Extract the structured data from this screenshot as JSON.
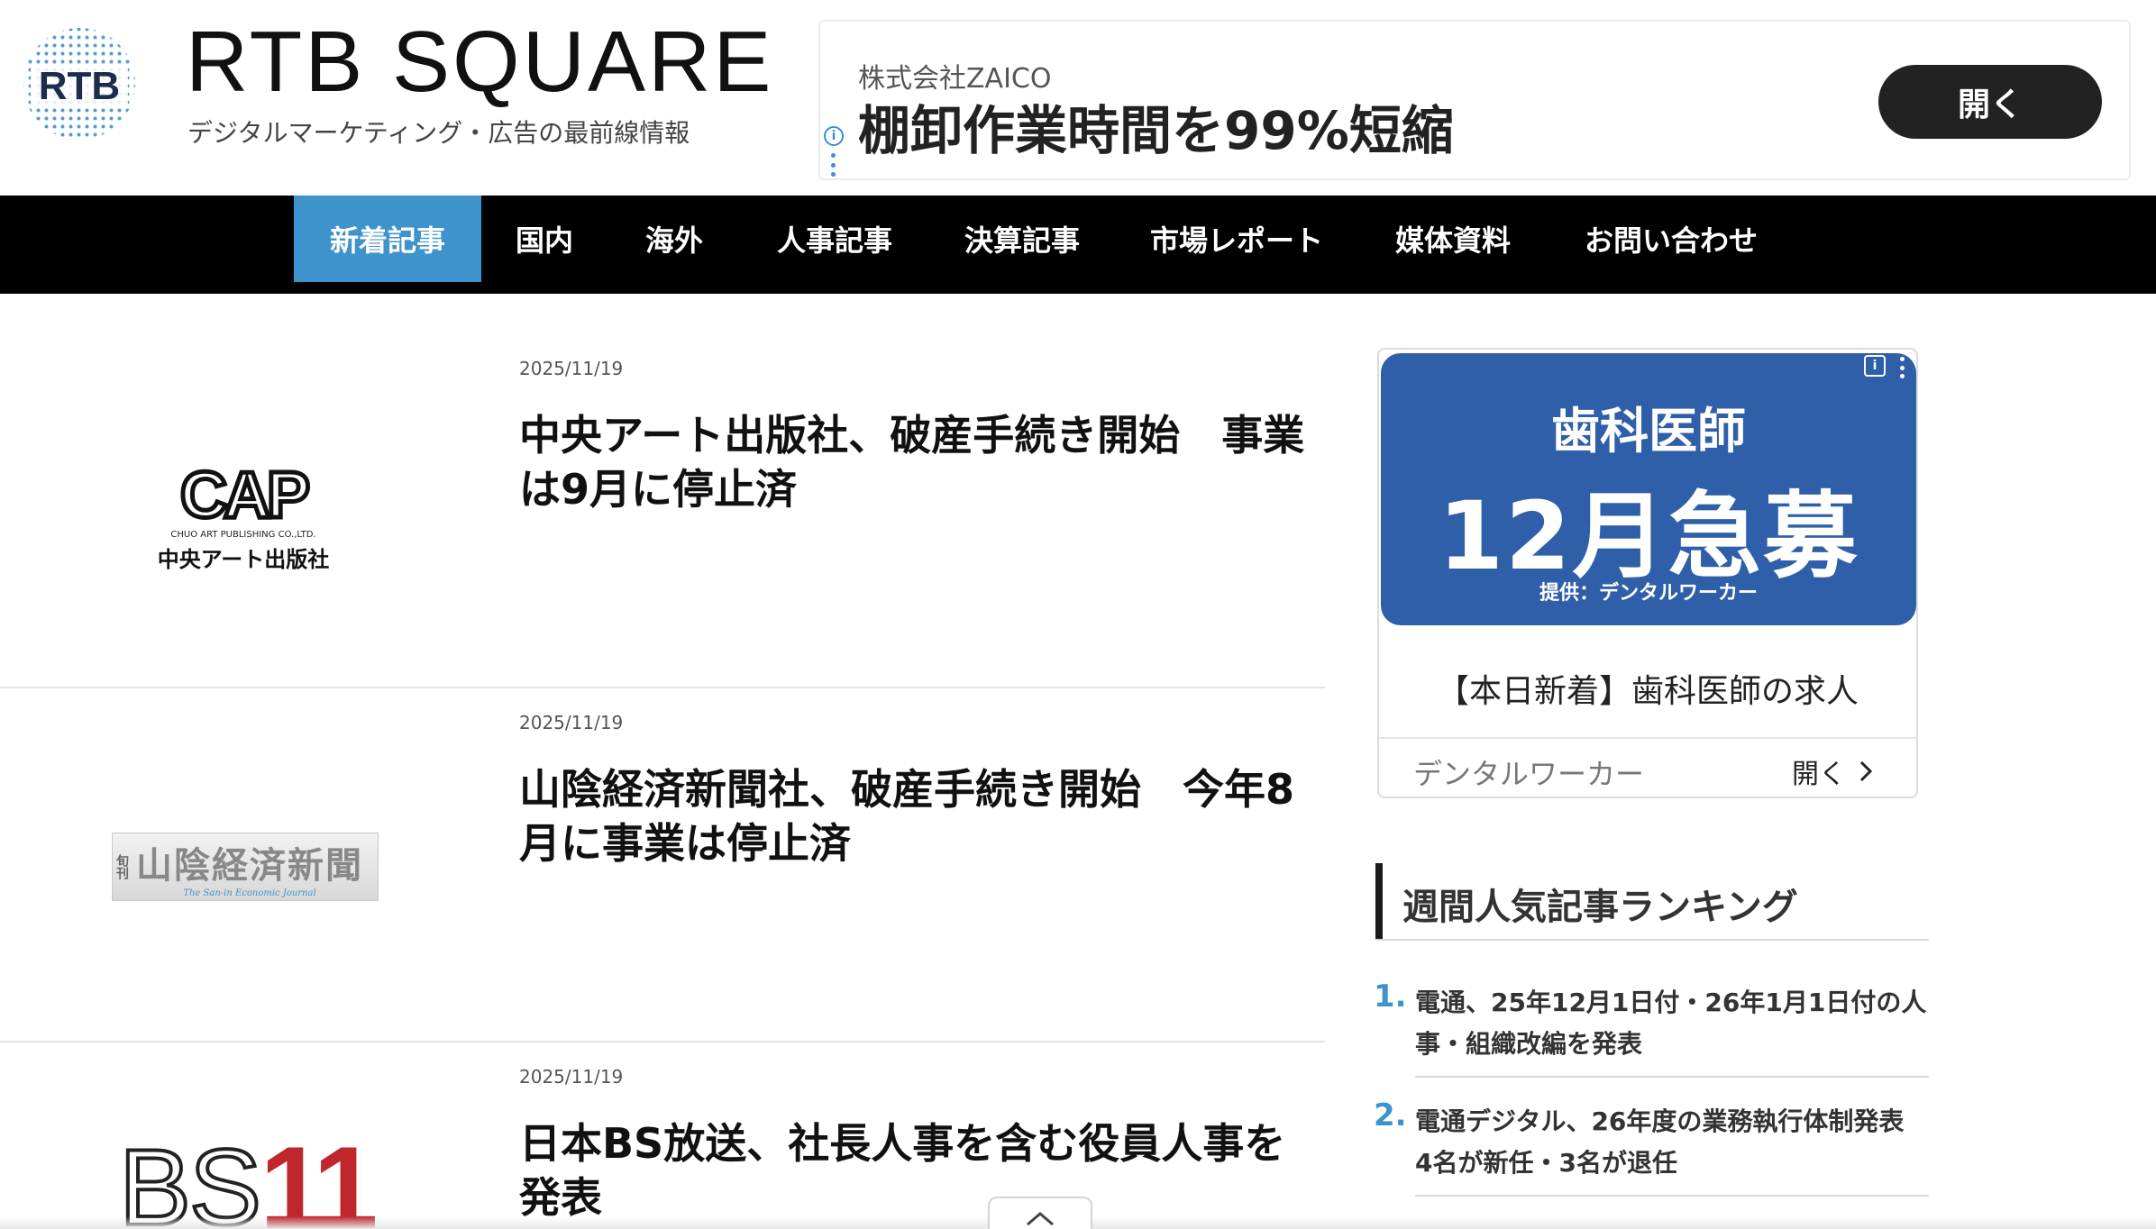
{
  "header": {
    "site_title": "RTB SQUARE",
    "logo_text": "RTB",
    "subtitle": "デジタルマーケティング・広告の最前線情報"
  },
  "top_ad": {
    "company": "株式会社ZAICO",
    "headline": "棚卸作業時間を99%短縮",
    "button": "開く",
    "info_icon": "i"
  },
  "nav": {
    "items": [
      {
        "label": "新着記事",
        "active": true
      },
      {
        "label": "国内",
        "active": false
      },
      {
        "label": "海外",
        "active": false
      },
      {
        "label": "人事記事",
        "active": false
      },
      {
        "label": "決算記事",
        "active": false
      },
      {
        "label": "市場レポート",
        "active": false
      },
      {
        "label": "媒体資料",
        "active": false
      },
      {
        "label": "お問い合わせ",
        "active": false
      }
    ]
  },
  "articles": [
    {
      "date": "2025/11/19",
      "title": "中央アート出版社、破産手続き開始　事業は9月に停止済",
      "logo": {
        "mark": "CAP",
        "sub": "CHUO ART PUBLISHING CO.,LTD.",
        "name": "中央アート出版社"
      }
    },
    {
      "date": "2025/11/19",
      "title": "山陰経済新聞社、破産手続き開始　今年8月に事業は停止済",
      "logo": {
        "prefix": "旬刊",
        "name": "山陰経済新聞",
        "sub": "The San-in Economic Journal"
      }
    },
    {
      "date": "2025/11/19",
      "title": "日本BS放送、社長人事を含む役員人事を発表",
      "logo": {
        "bs": "BS",
        "num": "11"
      }
    }
  ],
  "sidebar_ad": {
    "line1": "歯科医師",
    "line2": "12月急募",
    "line3": "提供：デンタルワーカー",
    "text": "【本日新着】歯科医師の求人",
    "advertiser": "デンタルワーカー",
    "open": "開く",
    "info_icon": "i"
  },
  "ranking": {
    "title": "週間人気記事ランキング",
    "items": [
      {
        "rank": "1.",
        "text": "電通、25年12月1日付・26年1月1日付の人事・組織改編を発表"
      },
      {
        "rank": "2.",
        "text": "電通デジタル、26年度の業務執行体制発表　4名が新任・3名が退任"
      }
    ]
  },
  "colors": {
    "accent": "#3e93cc",
    "nav_bg": "#000000",
    "ad_blue": "#2f5fa8",
    "logo_red": "#c0272d"
  }
}
